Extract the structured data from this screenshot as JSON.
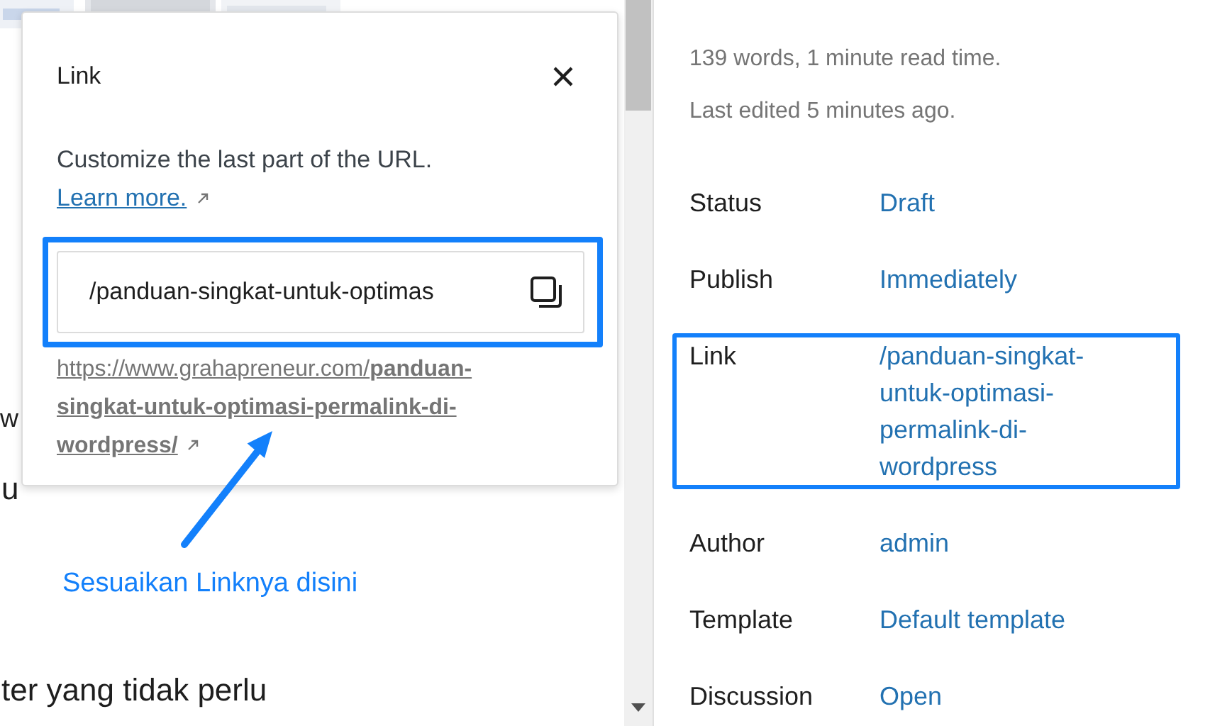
{
  "editor_lines": [
    "w",
    "u",
    "ter yang tidak perlu"
  ],
  "popover": {
    "title": "Link",
    "description": "Customize the last part of the URL.",
    "learn_more": "Learn more.",
    "field_value": "/panduan-singkat-untuk-optimas",
    "url_base": "https://www.grahapreneur.com/",
    "url_slug": "panduan-singkat-untuk-optimasi-permalink-di-wordpress/"
  },
  "annotation": {
    "label": "Sesuaikan Linknya disini"
  },
  "sidebar": {
    "stats": [
      "139 words, 1 minute read time.",
      "Last edited 5 minutes ago."
    ],
    "rows": [
      {
        "label": "Status",
        "value": "Draft",
        "highlighted": false
      },
      {
        "label": "Publish",
        "value": "Immediately",
        "highlighted": false
      },
      {
        "label": "Link",
        "value": "/panduan-singkat-untuk-optimasi-permalink-di-wordpress",
        "highlighted": true
      },
      {
        "label": "Author",
        "value": "admin",
        "highlighted": false
      },
      {
        "label": "Template",
        "value": "Default template",
        "highlighted": false
      },
      {
        "label": "Discussion",
        "value": "Open",
        "highlighted": false
      }
    ]
  }
}
